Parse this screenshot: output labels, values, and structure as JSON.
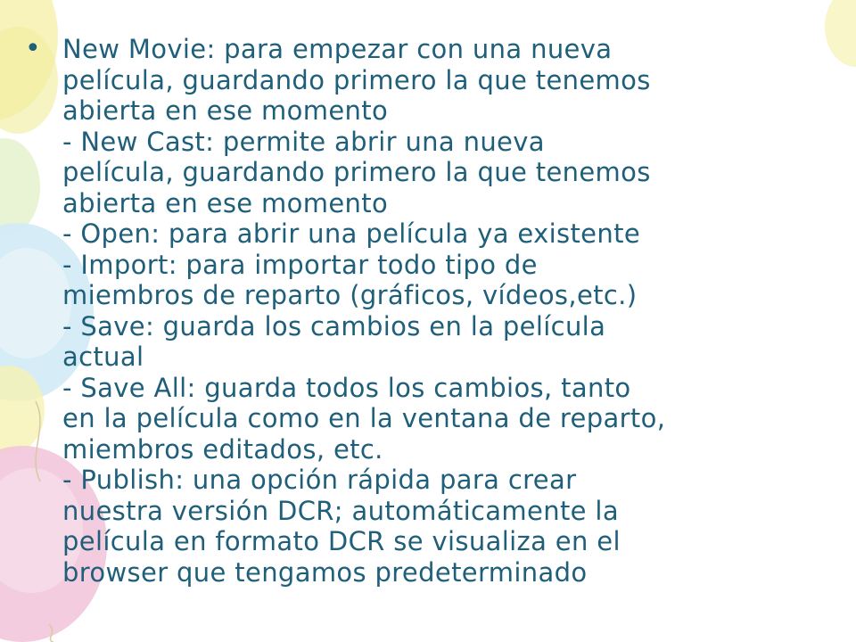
{
  "slide": {
    "bullet_symbol": "•",
    "lines": [
      "New Movie: para empezar con una nueva",
      "película, guardando primero la que tenemos",
      "abierta en ese momento",
      "- New Cast: permite abrir una nueva",
      "película, guardando primero la que tenemos",
      "abierta en ese momento",
      "- Open: para abrir una película ya existente",
      "- Import: para importar todo tipo de",
      "miembros de reparto (gráficos, vídeos,etc.)",
      "- Save: guarda los cambios en la película",
      "actual",
      "- Save All: guarda todos los cambios, tanto",
      "en la película como en la ventana de reparto,",
      "miembros editados, etc.",
      "- Publish: una opción rápida para crear",
      "nuestra versión DCR; automáticamente la",
      "película en formato DCR se visualiza en el",
      "browser que tengamos predeterminado"
    ]
  },
  "colors": {
    "text": "#1f5f7a",
    "balloon_yellow": "#f4f0a8",
    "balloon_blue": "#cfe8f4",
    "balloon_pink": "#f2c6dc",
    "balloon_green": "#dcefc0"
  },
  "icons": {
    "background": "balloons-decoration"
  }
}
